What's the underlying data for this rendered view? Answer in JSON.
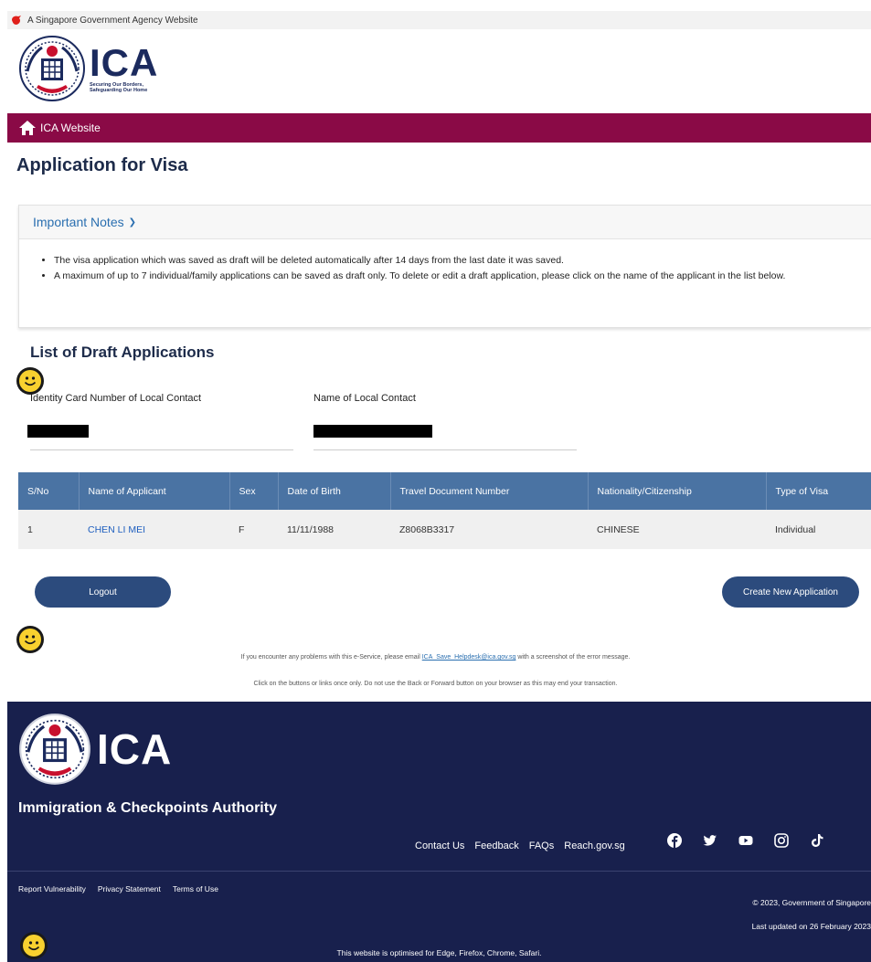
{
  "masthead": {
    "text": "A Singapore Government Agency Website"
  },
  "logo": {
    "name": "ICA",
    "tagline_line1": "Securing Our Borders,",
    "tagline_line2": "Safeguarding Our Home"
  },
  "nav": {
    "home_label": "ICA Website"
  },
  "page": {
    "title": "Application for Visa"
  },
  "notes": {
    "heading": "Important Notes",
    "items": [
      "The visa application which was saved as draft will be deleted automatically after 14 days from the last date it was saved.",
      "A maximum of up to 7 individual/family applications can be saved as draft only. To delete or edit a draft application, please click on the name of the applicant in the list below."
    ]
  },
  "drafts": {
    "title": "List of Draft Applications",
    "id_label": "Identity Card Number of Local Contact",
    "name_label": "Name of Local Contact",
    "columns": [
      "S/No",
      "Name of Applicant",
      "Sex",
      "Date of Birth",
      "Travel Document Number",
      "Nationality/Citizenship",
      "Type of Visa"
    ],
    "rows": [
      {
        "sno": "1",
        "name": "CHEN LI MEI",
        "sex": "F",
        "dob": "11/11/1988",
        "doc": "Z8068B3317",
        "nationality": "CHINESE",
        "type": "Individual"
      }
    ]
  },
  "buttons": {
    "logout": "Logout",
    "create": "Create New Application"
  },
  "help": {
    "line1_pre": "If you encounter any problems with this e-Service, please email ",
    "email": "ICA_Save_Helpdesk@ica.gov.sg",
    "line1_post": " with a screenshot of the error message.",
    "line2": "Click on the buttons or links once only. Do not use the Back or Forward button on your browser as this may end your transaction."
  },
  "footer": {
    "logo_text": "ICA",
    "agency": "Immigration & Checkpoints Authority",
    "links": [
      "Contact Us",
      "Feedback",
      "FAQs",
      "Reach.gov.sg"
    ],
    "social": [
      "facebook-icon",
      "twitter-icon",
      "youtube-icon",
      "instagram-icon",
      "tiktok-icon"
    ],
    "legal": [
      "Report Vulnerability",
      "Privacy Statement",
      "Terms of Use"
    ],
    "copyright": "© 2023, Government of Singapore",
    "updated": "Last updated on 26 February 2023",
    "optimised": "This website is optimised for Edge, Firefox, Chrome, Safari."
  },
  "colors": {
    "nav_maroon": "#8a0a46",
    "table_header": "#4a73a3",
    "button": "#2c4b7d",
    "footer": "#18204d",
    "link": "#1f5fbf"
  }
}
